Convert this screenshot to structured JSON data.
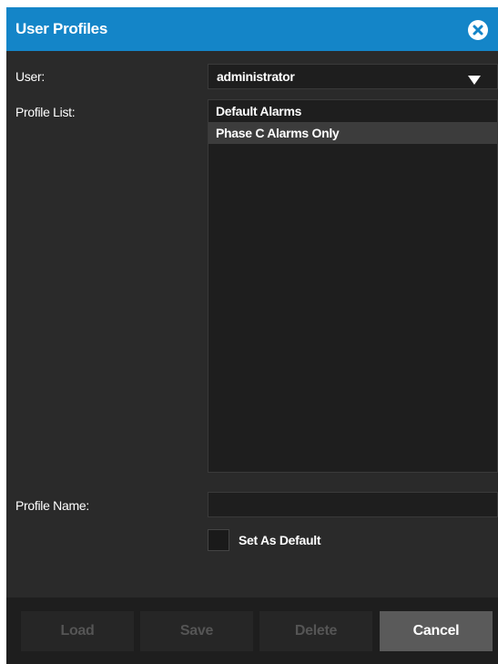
{
  "dialog": {
    "title": "User Profiles",
    "close_icon": "close-circle-icon"
  },
  "user": {
    "label": "User:",
    "selected": "administrator",
    "dropdown_icon": "caret-down-icon"
  },
  "profile_list": {
    "label": "Profile List:",
    "items": [
      {
        "label": "Default Alarms",
        "selected": false
      },
      {
        "label": "Phase C Alarms Only",
        "selected": true
      }
    ]
  },
  "profile_name": {
    "label": "Profile Name:",
    "value": "",
    "placeholder": ""
  },
  "set_default": {
    "label": "Set As Default",
    "checked": false
  },
  "buttons": {
    "load": {
      "label": "Load",
      "enabled": false
    },
    "save": {
      "label": "Save",
      "enabled": false
    },
    "delete": {
      "label": "Delete",
      "enabled": false
    },
    "cancel": {
      "label": "Cancel",
      "enabled": true
    }
  },
  "colors": {
    "title_bar": "#1485c8",
    "dialog_background": "#2a2a2a",
    "footer_background": "#1e1e1e",
    "cancel_button": "#5a5a5a",
    "disabled_button": "#262626",
    "disabled_text": "#555555"
  }
}
